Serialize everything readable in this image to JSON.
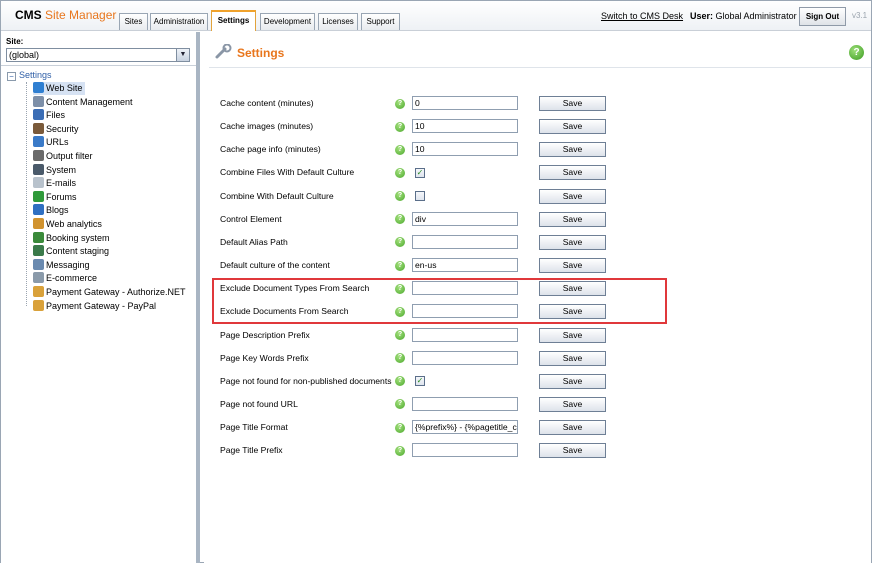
{
  "header": {
    "logo_cms": "CMS",
    "logo_rest": "Site Manager",
    "tabs": [
      "Sites",
      "Administration",
      "Settings",
      "Development",
      "Licenses",
      "Support"
    ],
    "active_tab": "Settings",
    "switch_link": "Switch to CMS Desk",
    "user_label": "User:",
    "user_name": "Global Administrator",
    "signout": "Sign Out",
    "version": "v3.1"
  },
  "left": {
    "site_label": "Site:",
    "site_value": "(global)",
    "tree_root": "Settings",
    "tree_items": [
      {
        "label": "Web Site",
        "icon": "globe-icon",
        "color": "#2f7fd1"
      },
      {
        "label": "Content Management",
        "icon": "document-edit-icon",
        "color": "#7d8fa8"
      },
      {
        "label": "Files",
        "icon": "files-icon",
        "color": "#3b6db5"
      },
      {
        "label": "Security",
        "icon": "security-icon",
        "color": "#7a5a3a"
      },
      {
        "label": "URLs",
        "icon": "url-icon",
        "color": "#3a7ac8"
      },
      {
        "label": "Output filter",
        "icon": "filter-icon",
        "color": "#6a6a6a"
      },
      {
        "label": "System",
        "icon": "system-icon",
        "color": "#4a5a6a"
      },
      {
        "label": "E-mails",
        "icon": "email-icon",
        "color": "#b8c2cc"
      },
      {
        "label": "Forums",
        "icon": "forums-icon",
        "color": "#2f9a3a"
      },
      {
        "label": "Blogs",
        "icon": "blogs-icon",
        "color": "#2f6fc1"
      },
      {
        "label": "Web analytics",
        "icon": "analytics-icon",
        "color": "#d1932f"
      },
      {
        "label": "Booking system",
        "icon": "booking-icon",
        "color": "#3a8a3a"
      },
      {
        "label": "Content staging",
        "icon": "staging-icon",
        "color": "#3a7a4a"
      },
      {
        "label": "Messaging",
        "icon": "messaging-icon",
        "color": "#6a8ab0"
      },
      {
        "label": "E-commerce",
        "icon": "ecommerce-icon",
        "color": "#8a9aaa"
      },
      {
        "label": "Payment Gateway - Authorize.NET",
        "icon": "payment-icon",
        "color": "#d9a13a"
      },
      {
        "label": "Payment Gateway - PayPal",
        "icon": "payment-icon",
        "color": "#d9a13a"
      }
    ]
  },
  "main": {
    "title": "Settings",
    "help": "?",
    "save_label": "Save",
    "rows": [
      {
        "label": "Cache content (minutes)",
        "type": "text",
        "value": "0"
      },
      {
        "label": "Cache images (minutes)",
        "type": "text",
        "value": "10"
      },
      {
        "label": "Cache page info (minutes)",
        "type": "text",
        "value": "10"
      },
      {
        "label": "Combine Files With Default Culture",
        "type": "check",
        "value": "✓"
      },
      {
        "label": "Combine With Default Culture",
        "type": "check",
        "value": ""
      },
      {
        "label": "Control Element",
        "type": "text",
        "value": "div"
      },
      {
        "label": "Default Alias Path",
        "type": "text",
        "value": ""
      },
      {
        "label": "Default culture of the content",
        "type": "text",
        "value": "en-us"
      },
      {
        "label": "Exclude Document Types From Search",
        "type": "text",
        "value": ""
      },
      {
        "label": "Exclude Documents From Search",
        "type": "text",
        "value": ""
      },
      {
        "label": "Page Description Prefix",
        "type": "text",
        "value": ""
      },
      {
        "label": "Page Key Words Prefix",
        "type": "text",
        "value": ""
      },
      {
        "label": "Page not found for non-published documents",
        "type": "check",
        "value": "✓"
      },
      {
        "label": "Page not found URL",
        "type": "text",
        "value": ""
      },
      {
        "label": "Page Title Format",
        "type": "text",
        "value": "{%prefix%} - {%pagetitle_c"
      },
      {
        "label": "Page Title Prefix",
        "type": "text",
        "value": ""
      }
    ]
  }
}
